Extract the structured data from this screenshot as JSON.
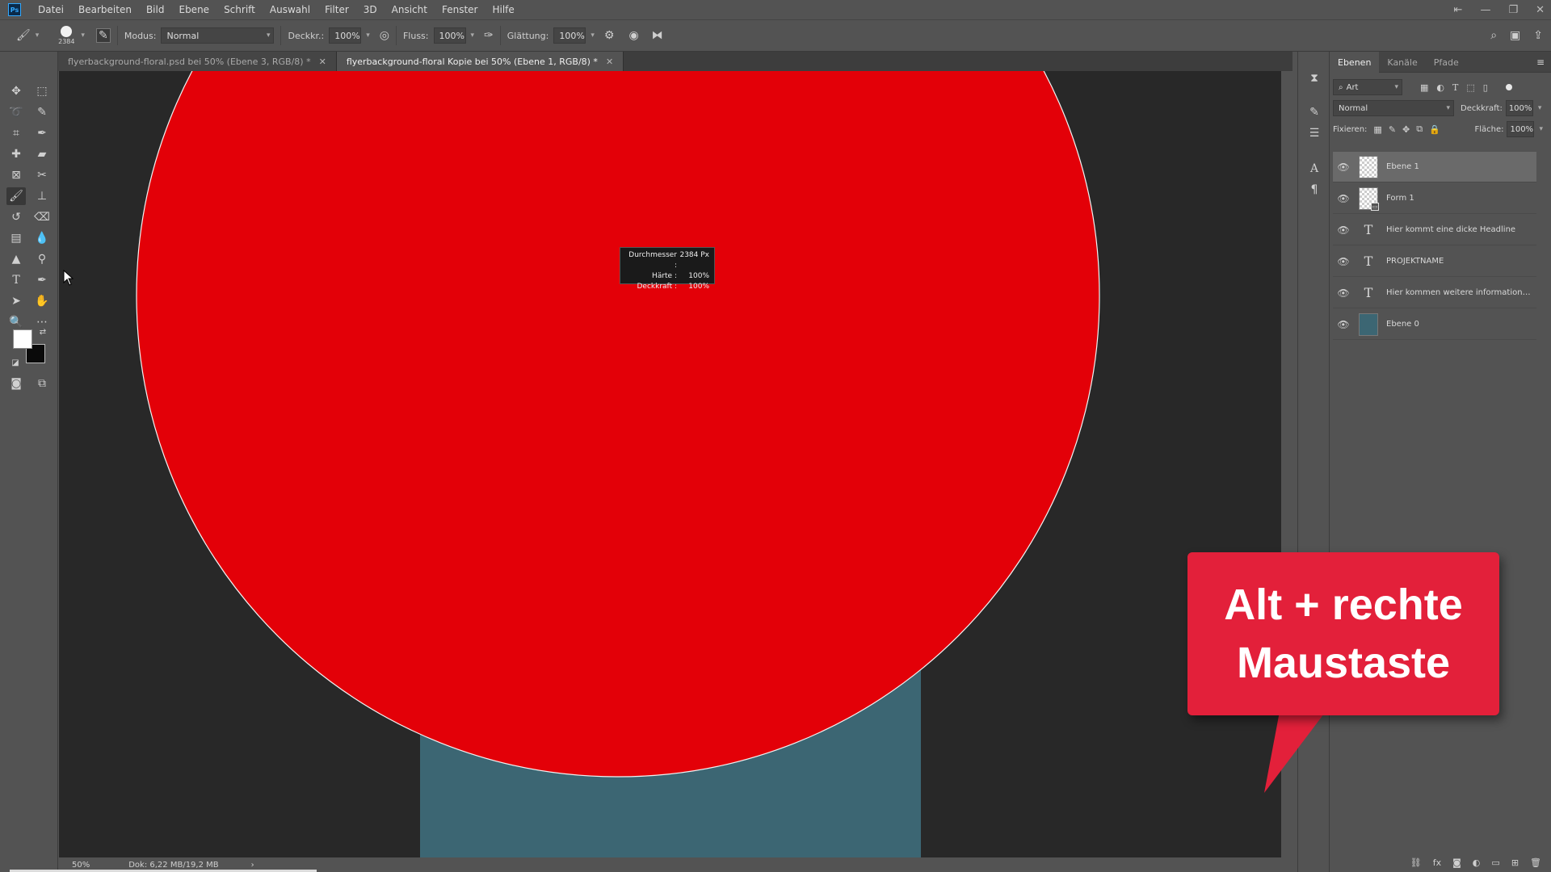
{
  "menu": {
    "logo": "Ps",
    "items": [
      "Datei",
      "Bearbeiten",
      "Bild",
      "Ebene",
      "Schrift",
      "Auswahl",
      "Filter",
      "3D",
      "Ansicht",
      "Fenster",
      "Hilfe"
    ]
  },
  "options": {
    "brush_size": "2384",
    "modus_label": "Modus:",
    "modus_value": "Normal",
    "deckkr_label": "Deckkr.:",
    "deckkr_value": "100%",
    "fluss_label": "Fluss:",
    "fluss_value": "100%",
    "glaettung_label": "Glättung:",
    "glaettung_value": "100%"
  },
  "tabs": [
    {
      "label": "flyerbackground-floral.psd bei 50% (Ebene 3, RGB/8) *",
      "active": false
    },
    {
      "label": "flyerbackground-floral Kopie bei 50% (Ebene 1, RGB/8) *",
      "active": true
    }
  ],
  "tooltip": {
    "rows": [
      {
        "k": "Durchmesser :",
        "v": "2384 Px"
      },
      {
        "k": "Härte :",
        "v": "100%"
      },
      {
        "k": "Deckkraft :",
        "v": "100%"
      }
    ]
  },
  "status": {
    "zoom": "50%",
    "doc": "Dok: 6,22 MB/19,2 MB"
  },
  "panel": {
    "tabs": [
      "Ebenen",
      "Kanäle",
      "Pfade"
    ],
    "filter_placeholder": "Art",
    "blend_mode": "Normal",
    "deckkraft_label": "Deckkraft:",
    "deckkraft_value": "100%",
    "fixieren_label": "Fixieren:",
    "flaeche_label": "Fläche:",
    "flaeche_value": "100%",
    "layers": [
      {
        "name": "Ebene 1",
        "kind": "pixel",
        "selected": true
      },
      {
        "name": "Form 1",
        "kind": "shape",
        "selected": false
      },
      {
        "name": "Hier kommt  eine dicke Headline",
        "kind": "text",
        "selected": false
      },
      {
        "name": "PROJEKTNAME",
        "kind": "text",
        "selected": false
      },
      {
        "name": "Hier kommen weitere informatione...",
        "kind": "text",
        "selected": false
      },
      {
        "name": "Ebene 0",
        "kind": "fill",
        "selected": false
      }
    ]
  },
  "callout": {
    "line1": "Alt + rechte",
    "line2": "Maustaste"
  },
  "colors": {
    "circle": "#e30008",
    "rect": "#3c6673",
    "callout": "#e3203a",
    "canvas_bg": "#282828"
  }
}
